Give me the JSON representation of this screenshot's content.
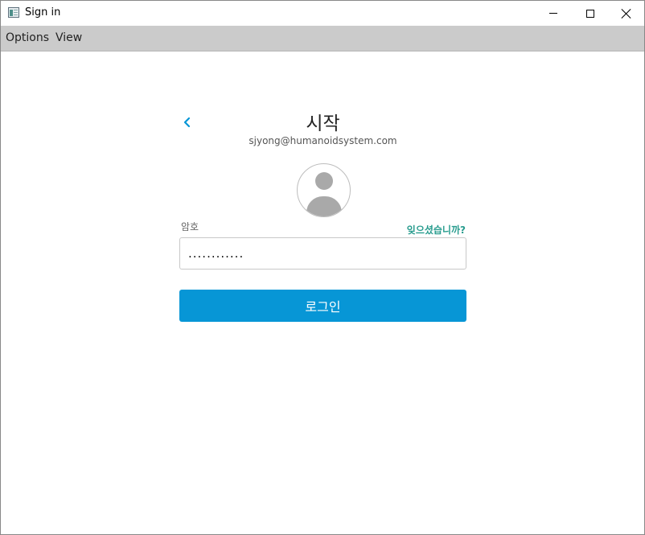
{
  "window": {
    "title": "Sign in"
  },
  "menu": {
    "options_label": "Options",
    "view_label": "View"
  },
  "signin": {
    "heading": "시작",
    "email": "sjyong@humanoidsystem.com",
    "password_label": "암호",
    "forgot_label": "잊으셨습니까?",
    "password_value": "............",
    "login_label": "로그인"
  },
  "colors": {
    "accent": "#0796d6",
    "link": "#2a9d8f",
    "menubar": "#cbcbcb"
  },
  "icons": {
    "back": "chevron-left-icon",
    "avatar": "user-avatar-icon",
    "app": "app-window-icon"
  }
}
